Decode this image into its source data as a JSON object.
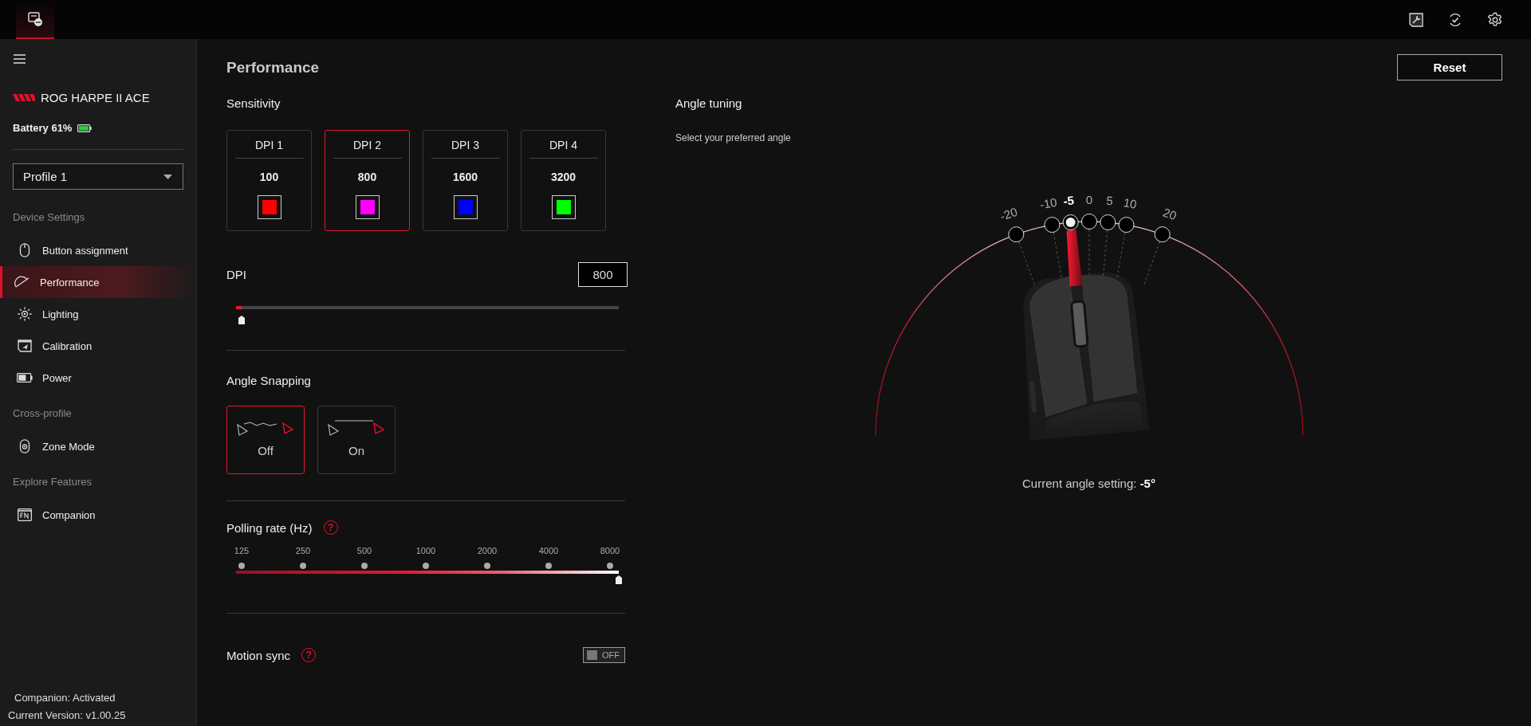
{
  "sidebar": {
    "device_name": "ROG HARPE II ACE",
    "battery": "Battery 61%",
    "profile": "Profile 1",
    "sections": [
      {
        "title": "Device Settings",
        "items": [
          {
            "label": "Button assignment",
            "selected": false
          },
          {
            "label": "Performance",
            "selected": true
          },
          {
            "label": "Lighting",
            "selected": false
          },
          {
            "label": "Calibration",
            "selected": false
          },
          {
            "label": "Power",
            "selected": false
          }
        ]
      },
      {
        "title": "Cross-profile",
        "items": [
          {
            "label": "Zone Mode",
            "selected": false
          }
        ]
      },
      {
        "title": "Explore Features",
        "items": [
          {
            "label": "Companion",
            "selected": false
          }
        ]
      }
    ],
    "footer": [
      "Companion: Activated",
      "Current Version: v1.00.25"
    ]
  },
  "main": {
    "title": "Performance",
    "reset": "Reset",
    "sensitivity": {
      "title": "Sensitivity",
      "presets": [
        {
          "label": "DPI 1",
          "value": "100",
          "color": "#ff0000",
          "selected": false
        },
        {
          "label": "DPI 2",
          "value": "800",
          "color": "#ff00ff",
          "selected": true
        },
        {
          "label": "DPI 3",
          "value": "1600",
          "color": "#0000ff",
          "selected": false
        },
        {
          "label": "DPI 4",
          "value": "3200",
          "color": "#00ff00",
          "selected": false
        }
      ]
    },
    "dpi": {
      "label": "DPI",
      "value": "800",
      "level": 0.015
    },
    "angle_snapping": {
      "title": "Angle Snapping",
      "options": [
        {
          "label": "Off",
          "kind": "wavy",
          "selected": true
        },
        {
          "label": "On",
          "kind": "straight",
          "selected": false
        }
      ]
    },
    "polling": {
      "title": "Polling rate (Hz)",
      "help": "?",
      "ticks": [
        "125",
        "250",
        "500",
        "1000",
        "2000",
        "4000",
        "8000"
      ],
      "level": 1
    },
    "motion_sync": {
      "title": "Motion sync",
      "help": "?",
      "on": false,
      "state_label": "OFF"
    },
    "angle_tuning": {
      "title": "Angle tuning",
      "subtitle": "Select your preferred angle",
      "marks": [
        {
          "label": "-20",
          "selected": false
        },
        {
          "label": "-10",
          "selected": false
        },
        {
          "label": "-5",
          "selected": true
        },
        {
          "label": "0",
          "selected": false
        },
        {
          "label": "5",
          "selected": false
        },
        {
          "label": "10",
          "selected": false
        },
        {
          "label": "20",
          "selected": false
        }
      ],
      "current": "Current angle setting: **-5°**"
    }
  }
}
